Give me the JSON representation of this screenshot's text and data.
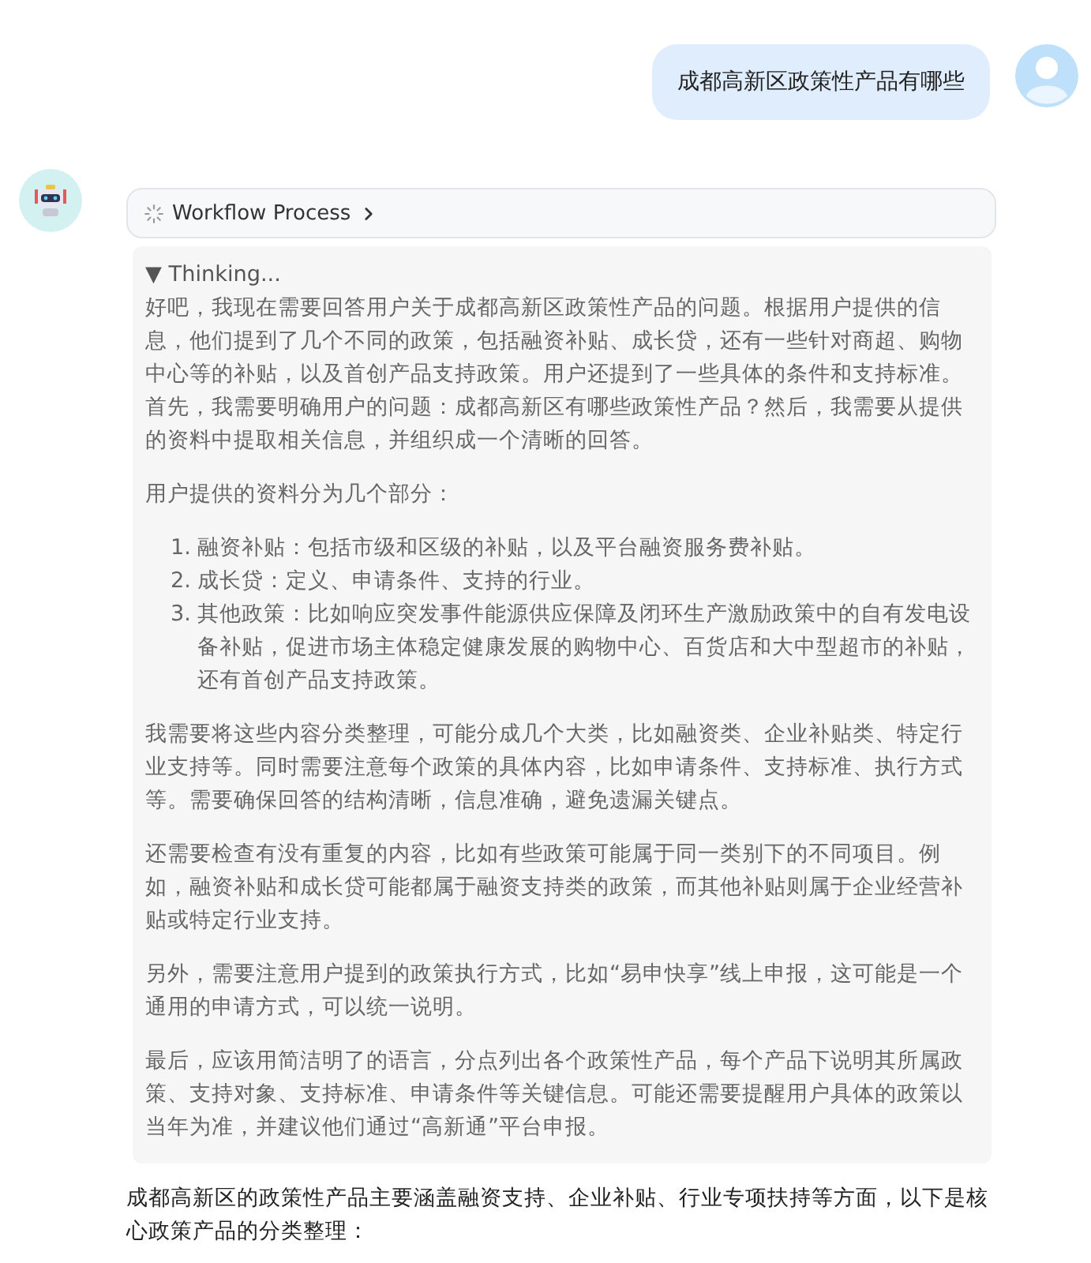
{
  "user_message": {
    "text": "成都高新区政策性产品有哪些"
  },
  "bot": {
    "workflow": {
      "label": "Workflow Process"
    },
    "thinking": {
      "label": "▼ Thinking...",
      "blocks": [
        {
          "kind": "paragraph",
          "text": "好吧，我现在需要回答用户关于成都高新区政策性产品的问题。根据用户提供的信息，他们提到了几个不同的政策，包括融资补贴、成长贷，还有一些针对商超、购物中心等的补贴，以及首创产品支持政策。用户还提到了一些具体的条件和支持标准。首先，我需要明确用户的问题：成都高新区有哪些政策性产品？然后，我需要从提供的资料中提取相关信息，并组织成一个清晰的回答。"
        },
        {
          "kind": "paragraph",
          "text": "用户提供的资料分为几个部分："
        },
        {
          "kind": "list",
          "items": [
            {
              "marker": "1.",
              "text": "融资补贴：包括市级和区级的补贴，以及平台融资服务费补贴。"
            },
            {
              "marker": "2.",
              "text": "成长贷：定义、申请条件、支持的行业。"
            },
            {
              "marker": "3.",
              "text": "其他政策：比如响应突发事件能源供应保障及闭环生产激励政策中的自有发电设备补贴，促进市场主体稳定健康发展的购物中心、百货店和大中型超市的补贴，还有首创产品支持政策。"
            }
          ]
        },
        {
          "kind": "paragraph",
          "text": "我需要将这些内容分类整理，可能分成几个大类，比如融资类、企业补贴类、特定行业支持等。同时需要注意每个政策的具体内容，比如申请条件、支持标准、执行方式等。需要确保回答的结构清晰，信息准确，避免遗漏关键点。"
        },
        {
          "kind": "paragraph",
          "text": "还需要检查有没有重复的内容，比如有些政策可能属于同一类别下的不同项目。例如，融资补贴和成长贷可能都属于融资支持类的政策，而其他补贴则属于企业经营补贴或特定行业支持。"
        },
        {
          "kind": "paragraph",
          "text": "另外，需要注意用户提到的政策执行方式，比如“易申快享”线上申报，这可能是一个通用的申请方式，可以统一说明。"
        },
        {
          "kind": "paragraph",
          "text": "最后，应该用简洁明了的语言，分点列出各个政策性产品，每个产品下说明其所属政策、支持对象、支持标准、申请条件等关键信息。可能还需要提醒用户具体的政策以当年为准，并建议他们通过“高新通”平台申报。"
        }
      ]
    },
    "answer": "成都高新区的政策性产品主要涵盖融资支持、企业补贴、行业专项扶持等方面，以下是核心政策产品的分类整理："
  }
}
